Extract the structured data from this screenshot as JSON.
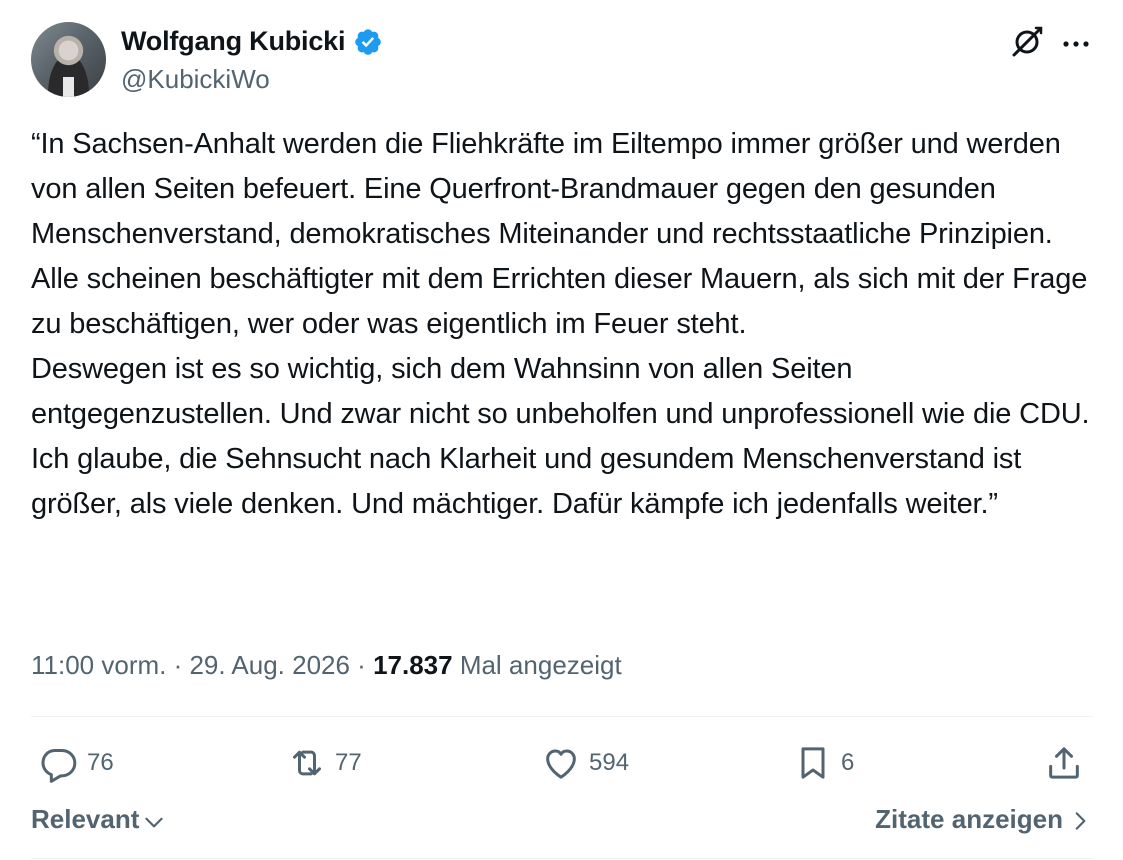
{
  "author": {
    "name": "Wolfgang Kubicki",
    "handle": "@KubickiWo",
    "verified": true
  },
  "tweet": {
    "text": "“In Sachsen-Anhalt werden die Fliehkräfte im Eiltempo immer größer und werden von allen Seiten befeuert. Eine Querfront-Brandmauer gegen den gesunden Menschenverstand, demokratisches Miteinander und rechtsstaatliche Prinzipien. Alle scheinen beschäftigter mit dem Errichten dieser Mauern, als sich mit der Frage zu beschäftigen, wer oder was eigentlich im Feuer steht.\nDeswegen ist es so wichtig, sich dem Wahnsinn von allen Seiten entgegenzustellen. Und zwar nicht so unbeholfen und unprofessionell wie die CDU. Ich glaube, die Sehnsucht nach Klarheit und gesundem Menschenverstand ist größer, als viele denken. Und mächtiger. Dafür kämpfe ich jedenfalls weiter.”",
    "time": "11:00 vorm.",
    "separator": " · ",
    "date": "29. Aug. 2026",
    "views": "17.837",
    "views_label": " Mal angezeigt"
  },
  "actions": {
    "replies": "76",
    "reposts": "77",
    "likes": "594",
    "bookmarks": "6"
  },
  "footer": {
    "sort_label": "Relevant",
    "quotes_label": "Zitate anzeigen"
  },
  "icons": {
    "verified": "verified-badge-icon",
    "grok": "grok-icon",
    "more": "more-icon",
    "reply": "reply-icon",
    "repost": "repost-icon",
    "like": "heart-icon",
    "bookmark": "bookmark-icon",
    "share": "share-icon"
  },
  "colors": {
    "text": "#0f1419",
    "secondary": "#536471",
    "verified": "#1d9bf0",
    "divider": "#eff3f4"
  }
}
